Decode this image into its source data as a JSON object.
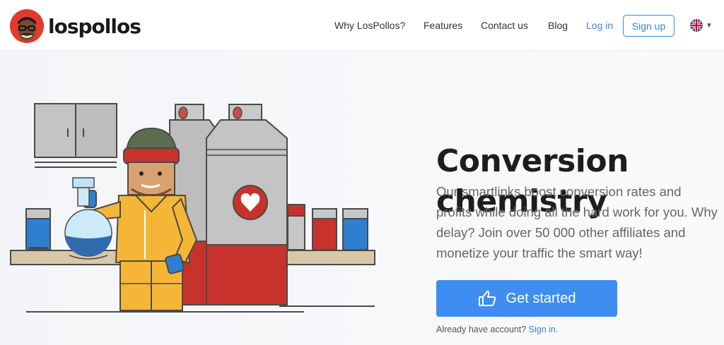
{
  "brand": {
    "name": "lospollos"
  },
  "nav": {
    "items": [
      {
        "label": "Why LosPollos?"
      },
      {
        "label": "Features"
      },
      {
        "label": "Contact us"
      },
      {
        "label": "Blog"
      }
    ],
    "login_label": "Log in",
    "signup_label": "Sign up",
    "language_icon": "uk-flag-icon"
  },
  "hero": {
    "title_line1": "Conversion",
    "title_line2": "chemistry",
    "description": "Our smartlinks boost conversion rates and profits while doing all the hard work for you. Why delay? Join over 50 000 other affiliates and monetize your traffic the smart way!",
    "cta_label": "Get started",
    "cta_icon": "thumbs-up-icon",
    "account_text": "Already have account?",
    "signin_label": "Sign in."
  },
  "colors": {
    "accent": "#3d8ef0",
    "link": "#3a86d6",
    "brand_red": "#e23b2e"
  }
}
